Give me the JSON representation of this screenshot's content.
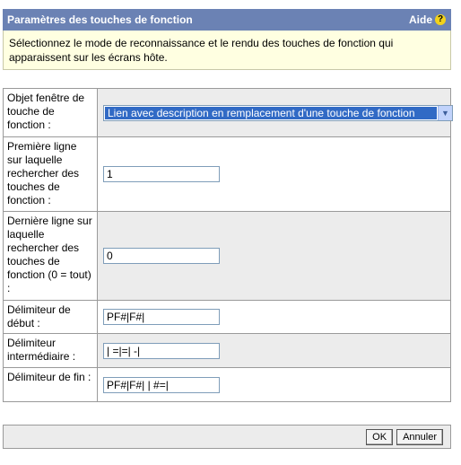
{
  "header": {
    "title": "Paramètres des touches de fonction",
    "help_label": "Aide",
    "help_icon": "?"
  },
  "description": "Sélectionnez le mode de reconnaissance et le rendu des touches de fonction qui apparaissent sur les écrans hôte.",
  "rows": [
    {
      "label": "Objet fenêtre de touche de fonction :",
      "selected": "Lien avec description en remplacement d'une touche de fonction"
    },
    {
      "label": "Première ligne sur laquelle rechercher des touches de fonction :",
      "value": "1"
    },
    {
      "label": "Dernière ligne sur laquelle rechercher des touches de fonction (0 = tout) :",
      "value": "0"
    },
    {
      "label": "Délimiteur de début :",
      "value": "PF#|F#|"
    },
    {
      "label": "Délimiteur intermédiaire :",
      "value": "| =|=| -|"
    },
    {
      "label": "Délimiteur de fin :",
      "value": "PF#|F#| | #=|"
    }
  ],
  "footer": {
    "ok_label": "OK",
    "cancel_label": "Annuler"
  }
}
